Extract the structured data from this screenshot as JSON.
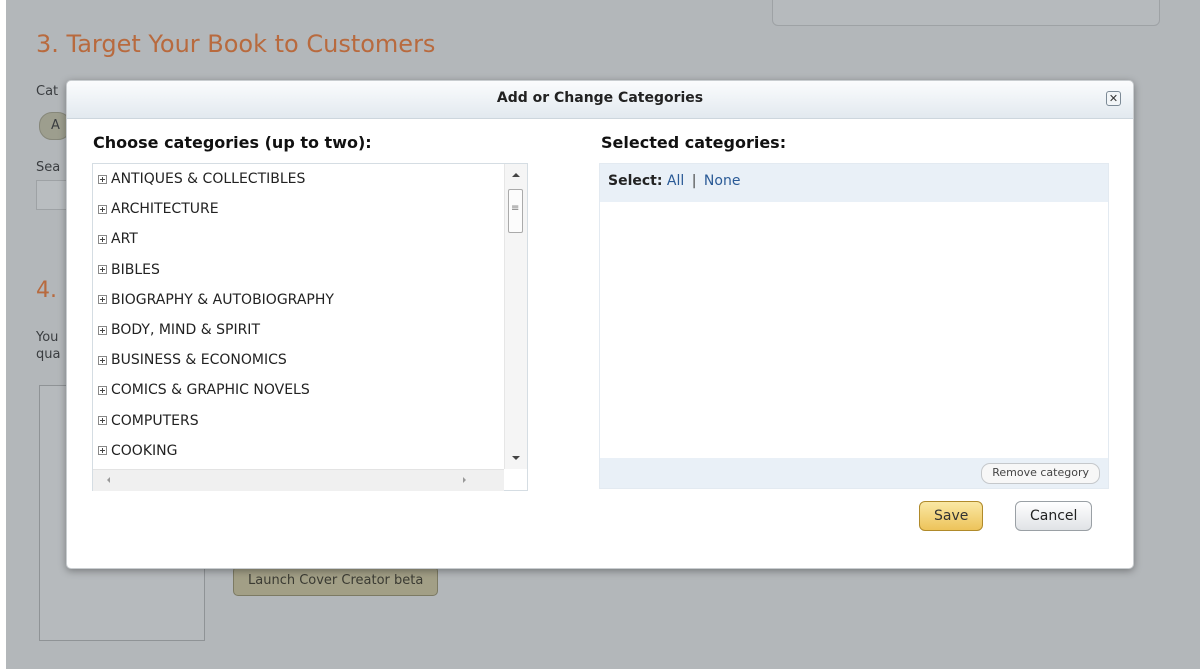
{
  "background": {
    "heading": "3. Target Your Book to Customers",
    "heading_4": "4.",
    "frag_cat": "Cat",
    "frag_a": "A",
    "frag_sea": "Sea",
    "frag_you": "You",
    "frag_qua": "qua",
    "launch_button": "Launch Cover Creator beta"
  },
  "dialog": {
    "title": "Add or Change Categories",
    "close_glyph": "✕",
    "choose_title": "Choose categories (up to two):",
    "selected_title": "Selected categories:",
    "categories": [
      "ANTIQUES & COLLECTIBLES",
      "ARCHITECTURE",
      "ART",
      "BIBLES",
      "BIOGRAPHY & AUTOBIOGRAPHY",
      "BODY, MIND & SPIRIT",
      "BUSINESS & ECONOMICS",
      "COMICS & GRAPHIC NOVELS",
      "COMPUTERS",
      "COOKING"
    ],
    "select_label": "Select:",
    "select_all": "All",
    "select_separator": "|",
    "select_none": "None",
    "remove_label": "Remove category",
    "save_label": "Save",
    "cancel_label": "Cancel"
  },
  "colors": {
    "heading_orange": "#b86a3e",
    "link_blue": "#2a5a96",
    "save_gold": "#edc35a"
  }
}
